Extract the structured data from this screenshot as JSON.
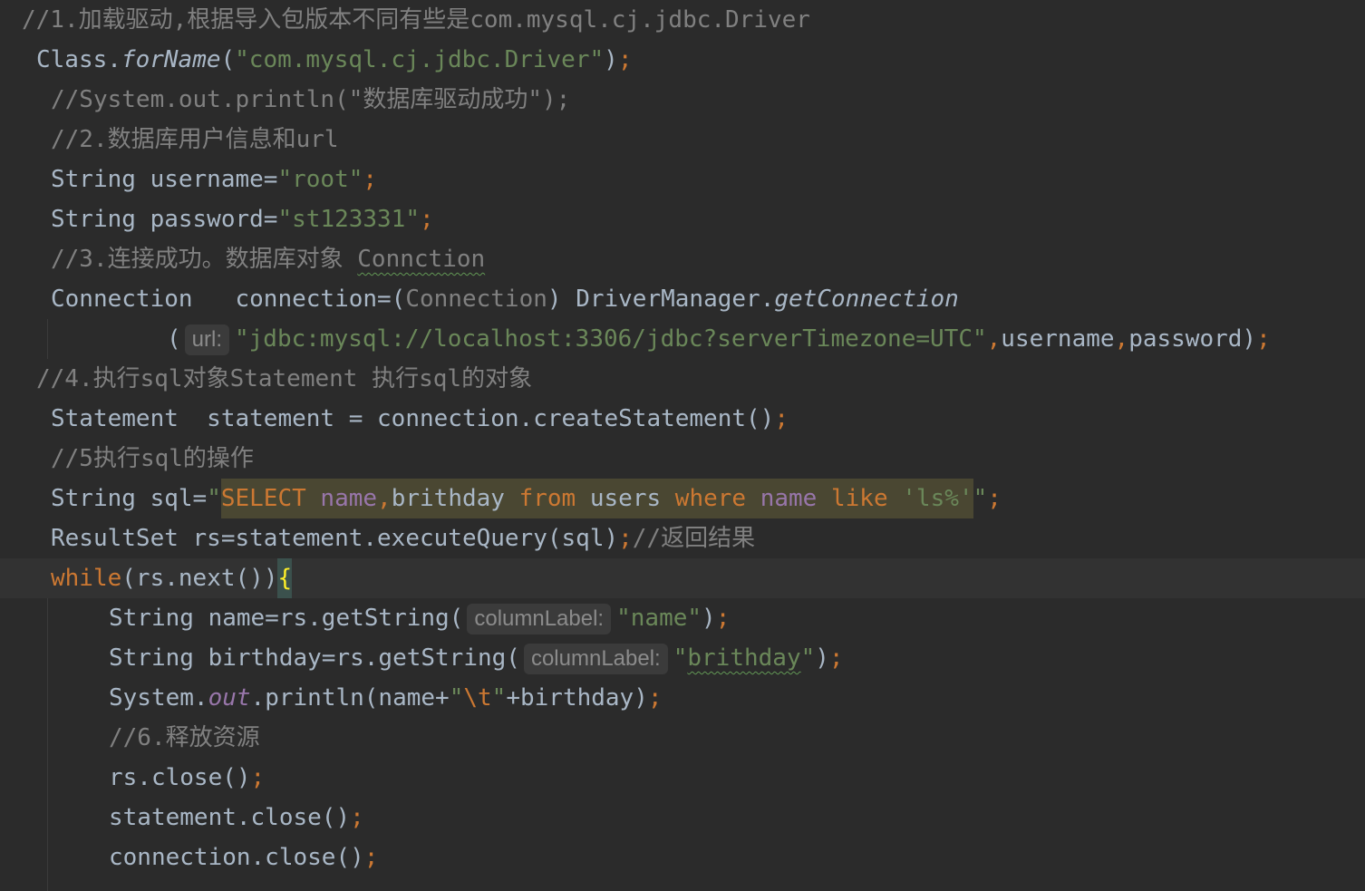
{
  "editor": {
    "lines": [
      {
        "id": 1,
        "indent": 24,
        "segments": [
          {
            "text": "//1.加载驱动,根据导入包版本不同有些是com.mysql.cj.jdbc.Driver",
            "color": "#808080"
          }
        ]
      },
      {
        "id": 2,
        "indent": 40,
        "segments": [
          {
            "text": "Class.",
            "color": "#a9b7c6"
          },
          {
            "text": "forName",
            "color": "#a9b7c6",
            "italic": true
          },
          {
            "text": "(",
            "color": "#a9b7c6"
          },
          {
            "text": "\"com.mysql.cj.jdbc.Driver\"",
            "color": "#6a8759"
          },
          {
            "text": ")",
            "color": "#a9b7c6"
          },
          {
            "text": ";",
            "color": "#cc7832"
          }
        ]
      },
      {
        "id": 3,
        "indent": 56,
        "segments": [
          {
            "text": "//System.out.println(\"数据库驱动成功\");",
            "color": "#808080"
          }
        ]
      },
      {
        "id": 4,
        "indent": 56,
        "segments": [
          {
            "text": "//2.数据库用户信息和url",
            "color": "#808080"
          }
        ]
      },
      {
        "id": 5,
        "indent": 56,
        "segments": [
          {
            "text": "String username=",
            "color": "#a9b7c6"
          },
          {
            "text": "\"root\"",
            "color": "#6a8759"
          },
          {
            "text": ";",
            "color": "#cc7832"
          }
        ]
      },
      {
        "id": 6,
        "indent": 56,
        "segments": [
          {
            "text": "String password=",
            "color": "#a9b7c6"
          },
          {
            "text": "\"st123331\"",
            "color": "#6a8759"
          },
          {
            "text": ";",
            "color": "#cc7832"
          }
        ]
      },
      {
        "id": 7,
        "indent": 56,
        "segments": [
          {
            "text": "//3.连接成功。数据库对象 ",
            "color": "#808080"
          },
          {
            "text": "Conncti​on",
            "color": "#808080",
            "squiggle": true
          }
        ]
      },
      {
        "id": 8,
        "indent": 56,
        "segments": [
          {
            "text": "Connection   connection=(",
            "color": "#a9b7c6"
          },
          {
            "text": "Connection",
            "color": "#808080"
          },
          {
            "text": ") DriverManager.",
            "color": "#a9b7c6"
          },
          {
            "text": "getConnection",
            "color": "#a9b7c6",
            "italic": true
          }
        ]
      },
      {
        "id": 9,
        "indent": 184,
        "segments": [
          {
            "text": "(",
            "color": "#a9b7c6"
          },
          {
            "hint": "url:"
          },
          {
            "text": "\"jdbc:mysql://localhost:3306/jdbc?serverTimezone=UTC\"",
            "color": "#6a8759"
          },
          {
            "text": ",",
            "color": "#cc7832"
          },
          {
            "text": "username",
            "color": "#a9b7c6"
          },
          {
            "text": ",",
            "color": "#cc7832"
          },
          {
            "text": "password)",
            "color": "#a9b7c6"
          },
          {
            "text": ";",
            "color": "#cc7832"
          }
        ]
      },
      {
        "id": 10,
        "indent": 40,
        "segments": [
          {
            "text": "//4.执行sql对象Statement 执行sql的对象",
            "color": "#808080"
          }
        ]
      },
      {
        "id": 11,
        "indent": 56,
        "segments": [
          {
            "text": "Statement  statement = connection.createStatement()",
            "color": "#a9b7c6"
          },
          {
            "text": ";",
            "color": "#cc7832"
          }
        ]
      },
      {
        "id": 12,
        "indent": 56,
        "segments": [
          {
            "text": "//5执行sql的操作",
            "color": "#808080"
          }
        ]
      },
      {
        "id": 13,
        "indent": 56,
        "segments": [
          {
            "text": "String sql=",
            "color": "#a9b7c6"
          },
          {
            "text": "\"",
            "color": "#6a8759"
          },
          {
            "text": "SELECT ",
            "color": "#cc7832",
            "sql": true
          },
          {
            "text": "name",
            "color": "#9876aa",
            "sql": true
          },
          {
            "text": ",",
            "color": "#cc7832",
            "sql": true
          },
          {
            "text": "brithday ",
            "color": "#a9b7c6",
            "sql": true
          },
          {
            "text": "from ",
            "color": "#cc7832",
            "sql": true
          },
          {
            "text": "users ",
            "color": "#a9b7c6",
            "sql": true
          },
          {
            "text": "where ",
            "color": "#cc7832",
            "sql": true
          },
          {
            "text": "name ",
            "color": "#9876aa",
            "sql": true
          },
          {
            "text": "like ",
            "color": "#cc7832",
            "sql": true
          },
          {
            "text": "'ls%'",
            "color": "#6a8759",
            "sql": true
          },
          {
            "text": "\"",
            "color": "#6a8759"
          },
          {
            "text": ";",
            "color": "#cc7832"
          }
        ]
      },
      {
        "id": 14,
        "indent": 56,
        "segments": [
          {
            "text": "ResultSet rs=statement.executeQuery(sql)",
            "color": "#a9b7c6"
          },
          {
            "text": ";",
            "color": "#cc7832"
          },
          {
            "text": "//返回结果",
            "color": "#808080"
          }
        ]
      },
      {
        "id": 15,
        "indent": 56,
        "current": true,
        "segments": [
          {
            "text": "while",
            "color": "#cc7832"
          },
          {
            "text": "(rs.next())",
            "color": "#a9b7c6"
          },
          {
            "text": "{",
            "color": "#ffef28",
            "bracket": true
          }
        ]
      },
      {
        "id": 16,
        "indent": 120,
        "segments": [
          {
            "text": "String name=rs.getString(",
            "color": "#a9b7c6"
          },
          {
            "hint": "columnLabel:"
          },
          {
            "text": "\"name\"",
            "color": "#6a8759"
          },
          {
            "text": ")",
            "color": "#a9b7c6"
          },
          {
            "text": ";",
            "color": "#cc7832"
          }
        ]
      },
      {
        "id": 17,
        "indent": 120,
        "segments": [
          {
            "text": "String birthday=rs.getString(",
            "color": "#a9b7c6"
          },
          {
            "hint": "columnLabel:"
          },
          {
            "text": "\"",
            "color": "#6a8759"
          },
          {
            "text": "brithday",
            "color": "#6a8759",
            "squiggle": true
          },
          {
            "text": "\"",
            "color": "#6a8759"
          },
          {
            "text": ")",
            "color": "#a9b7c6"
          },
          {
            "text": ";",
            "color": "#cc7832"
          }
        ]
      },
      {
        "id": 18,
        "indent": 120,
        "segments": [
          {
            "text": "System.",
            "color": "#a9b7c6"
          },
          {
            "text": "out",
            "color": "#9876aa",
            "italic": true
          },
          {
            "text": ".println(name+",
            "color": "#a9b7c6"
          },
          {
            "text": "\"",
            "color": "#6a8759"
          },
          {
            "text": "\\t",
            "color": "#cc7832"
          },
          {
            "text": "\"",
            "color": "#6a8759"
          },
          {
            "text": "+birthday)",
            "color": "#a9b7c6"
          },
          {
            "text": ";",
            "color": "#cc7832"
          }
        ]
      },
      {
        "id": 19,
        "indent": 120,
        "segments": [
          {
            "text": "//6.释放资源",
            "color": "#808080"
          }
        ]
      },
      {
        "id": 20,
        "indent": 120,
        "segments": [
          {
            "text": "rs.close()",
            "color": "#a9b7c6"
          },
          {
            "text": ";",
            "color": "#cc7832"
          }
        ]
      },
      {
        "id": 21,
        "indent": 120,
        "segments": [
          {
            "text": "statement.close()",
            "color": "#a9b7c6"
          },
          {
            "text": ";",
            "color": "#cc7832"
          }
        ]
      },
      {
        "id": 22,
        "indent": 120,
        "segments": [
          {
            "text": "connection.close()",
            "color": "#a9b7c6"
          },
          {
            "text": ";",
            "color": "#cc7832"
          }
        ]
      }
    ]
  },
  "colors": {
    "background": "#2b2b2b",
    "current_line": "#323232",
    "comment": "#808080",
    "keyword": "#cc7832",
    "string": "#6a8759",
    "field": "#9876aa",
    "plain": "#a9b7c6",
    "sql_injection_bg": "#4a4732",
    "brace_match": "#ffef28"
  }
}
